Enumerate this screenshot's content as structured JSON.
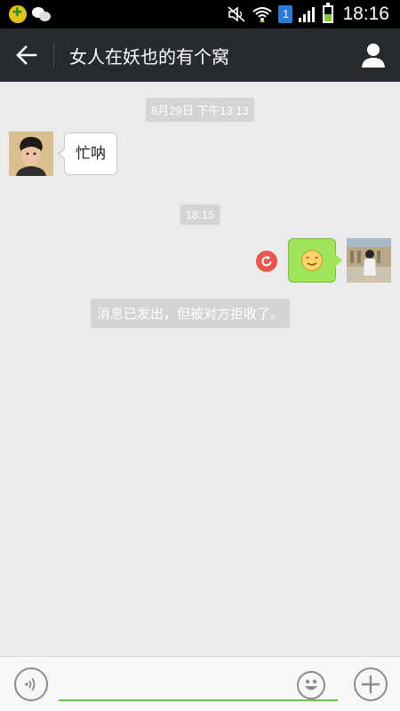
{
  "status_bar": {
    "time": "18:16",
    "sim_slot": "1",
    "icons": [
      "app-notification-icon",
      "wechat-icon",
      "mute-icon",
      "wifi-icon",
      "signal-icon",
      "battery-icon"
    ]
  },
  "header": {
    "title": "女人在妖也的有个窝",
    "back_icon": "arrow-left-icon",
    "profile_icon": "person-icon"
  },
  "messages": {
    "timestamp_1": "8月29日 下午13:13",
    "incoming_text": "忙呐",
    "timestamp_2": "18:15",
    "outgoing_content": "emoji-heart-eyes",
    "resend_icon": "resend-icon",
    "system_notice": "消息已发出，但被对方拒收了。"
  },
  "input_bar": {
    "placeholder": "",
    "voice_icon": "voice-icon",
    "emoji_icon": "emoji-icon",
    "plus_icon": "plus-icon"
  },
  "colors": {
    "header_bg": "#272a2f",
    "chat_bg": "#ebebeb",
    "sent_bubble": "#9fe55a",
    "resend_red": "#e8574e",
    "input_underline": "#6cc04a"
  }
}
